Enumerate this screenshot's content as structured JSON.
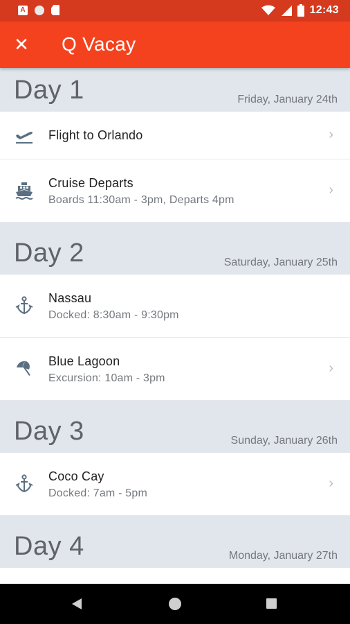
{
  "status_bar": {
    "time": "12:43",
    "left_icons": [
      "badge-icon",
      "circle-icon",
      "sd-card-icon"
    ],
    "right_icons": [
      "wifi-icon",
      "signal-icon",
      "battery-icon"
    ]
  },
  "app_bar": {
    "close_glyph": "✕",
    "title": "Q Vacay",
    "color": "#f4421f"
  },
  "days": [
    {
      "title": "Day 1",
      "date": "Friday, January 24th",
      "items": [
        {
          "icon": "flight-takeoff-icon",
          "title": "Flight to Orlando",
          "subtitle": "",
          "chevron": true
        },
        {
          "icon": "cruise-ship-icon",
          "title": "Cruise Departs",
          "subtitle": "Boards 11:30am - 3pm, Departs 4pm",
          "chevron": true
        }
      ]
    },
    {
      "title": "Day 2",
      "date": "Saturday, January 25th",
      "items": [
        {
          "icon": "anchor-icon",
          "title": "Nassau",
          "subtitle": "Docked: 8:30am - 9:30pm",
          "chevron": false
        },
        {
          "icon": "beach-umbrella-icon",
          "title": "Blue Lagoon",
          "subtitle": "Excursion: 10am - 3pm",
          "chevron": true
        }
      ]
    },
    {
      "title": "Day 3",
      "date": "Sunday, January 26th",
      "items": [
        {
          "icon": "anchor-icon",
          "title": "Coco Cay",
          "subtitle": "Docked: 7am - 5pm",
          "chevron": true
        }
      ]
    },
    {
      "title": "Day 4",
      "date": "Monday, January 27th",
      "items": []
    }
  ],
  "chevron_glyph": "›",
  "nav_bar": [
    "back-button",
    "home-button",
    "recents-button"
  ]
}
